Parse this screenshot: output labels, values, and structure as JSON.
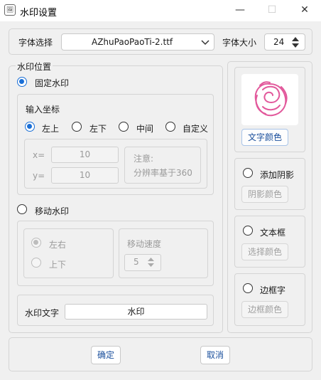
{
  "window": {
    "title": "水印设置",
    "app_icon": "image-settings-icon"
  },
  "font": {
    "select_label": "字体选择",
    "selected_font": "AZhuPaoPaoTi-2.ttf",
    "size_label": "字体大小",
    "size_value": "24"
  },
  "position": {
    "section_title": "水印位置",
    "fixed_label": "固定水印",
    "coords_title": "输入坐标",
    "options": [
      "左上",
      "左下",
      "中间",
      "自定义"
    ],
    "x_label": "x=",
    "x_value": "10",
    "y_label": "y=",
    "y_value": "10",
    "note_line1": "注意:",
    "note_line2": "分辨率基于360",
    "moving_label": "移动水印",
    "move_options": [
      "左右",
      "上下"
    ],
    "speed_label": "移动速度",
    "speed_value": "5"
  },
  "text": {
    "label": "水印文字",
    "value": "水印"
  },
  "right": {
    "text_color_btn": "文字颜色",
    "shadow_label": "添加阴影",
    "shadow_color_btn": "阴影颜色",
    "textbox_label": "文本框",
    "select_color_btn": "选择颜色",
    "border_label": "边框字",
    "border_color_btn": "边框颜色",
    "preview_icon": "rose-icon",
    "rose_color": "#e2589b"
  },
  "footer": {
    "ok": "确定",
    "cancel": "取消"
  },
  "colors": {
    "accent": "#1a6fd6",
    "link": "#1a4f9c"
  }
}
